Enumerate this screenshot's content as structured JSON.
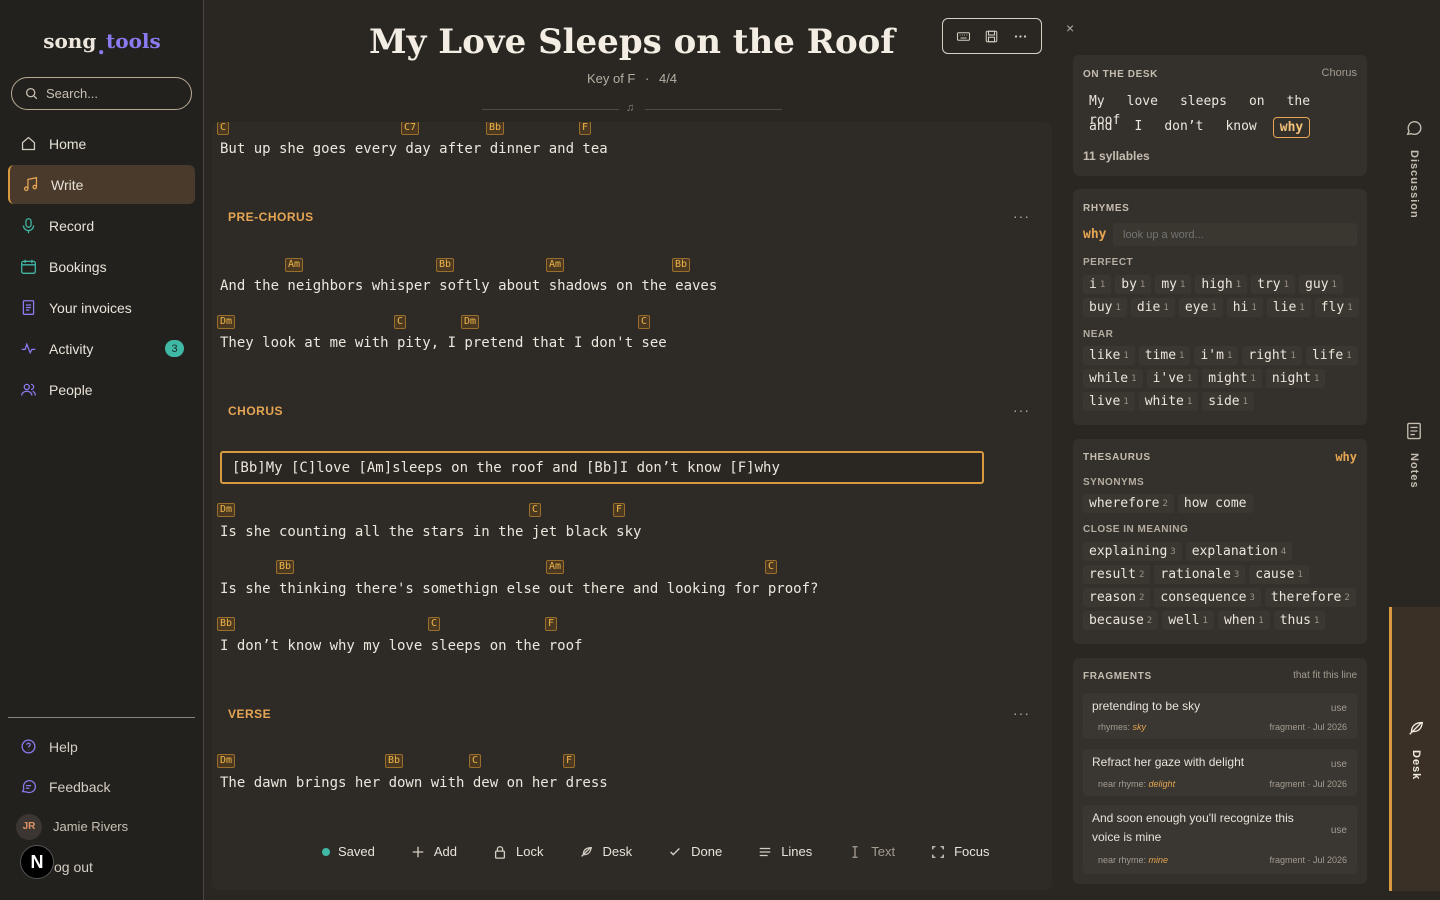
{
  "app": {
    "logo_a": "song",
    "logo_b": "tools"
  },
  "search": {
    "placeholder": "Search..."
  },
  "nav": {
    "home": "Home",
    "write": "Write",
    "record": "Record",
    "bookings": "Bookings",
    "invoices": "Your invoices",
    "activity": "Activity",
    "activity_badge": "3",
    "people": "People"
  },
  "bottom_nav": {
    "help": "Help",
    "feedback": "Feedback",
    "user_initials": "JR",
    "user_name": "Jamie Rivers",
    "logout": "og out",
    "n_logo": "N"
  },
  "song": {
    "title": "My Love Sleeps on the Roof",
    "key": "Key of F",
    "sep": "·",
    "time": "4/4"
  },
  "sections": {
    "pre_chorus": "PRE-CHORUS",
    "chorus": "CHORUS",
    "verse": "VERSE",
    "menu": "···"
  },
  "lines": {
    "l0": "But up she goes every day after dinner and tea",
    "l1": "And the neighbors whisper softly about shadows on the eaves",
    "l2": "They look at me with pity, I pretend that I don't see",
    "active": "[Bb]My [C]love [Am]sleeps on the roof and [Bb]I don’t know [F]why",
    "l3": "Is she counting all the stars in the jet black sky",
    "l4": "Is she thinking there's somethign else out there and looking for proof?",
    "l5": "I don’t know why my love sleeps on the roof",
    "l6": "The dawn brings her down with dew on her dress"
  },
  "chords": {
    "c0": [
      "C",
      "C7",
      "Bb",
      "F"
    ],
    "c1": [
      "Am",
      "Bb",
      "Am",
      "Bb"
    ],
    "c2": [
      "Dm",
      "C",
      "Dm",
      "C"
    ],
    "c3": [
      "Dm",
      "C",
      "F"
    ],
    "c4": [
      "Bb",
      "Am",
      "C"
    ],
    "c5": [
      "Bb",
      "C",
      "F"
    ],
    "c6": [
      "Dm",
      "Bb",
      "C",
      "F"
    ]
  },
  "bottom_tools": {
    "saved": "Saved",
    "add": "Add",
    "lock": "Lock",
    "desk": "Desk",
    "done": "Done",
    "lines": "Lines",
    "text": "Text",
    "focus": "Focus"
  },
  "desk": {
    "close": "×",
    "on_desk": {
      "label": "ON THE DESK",
      "section": "Chorus",
      "row1": [
        "My",
        "love",
        "sleeps",
        "on",
        "the",
        "roof"
      ],
      "row2": [
        "and",
        "I",
        "don’t",
        "know"
      ],
      "highlight": "why",
      "syllables": "11 syllables"
    },
    "rhymes": {
      "label": "RHYMES",
      "word": "why",
      "lookup_placeholder": "look up a word...",
      "perfect_label": "PERFECT",
      "perfect": [
        [
          "i",
          "1"
        ],
        [
          "by",
          "1"
        ],
        [
          "my",
          "1"
        ],
        [
          "high",
          "1"
        ],
        [
          "try",
          "1"
        ],
        [
          "guy",
          "1"
        ],
        [
          "buy",
          "1"
        ],
        [
          "die",
          "1"
        ],
        [
          "eye",
          "1"
        ],
        [
          "hi",
          "1"
        ],
        [
          "lie",
          "1"
        ],
        [
          "fly",
          "1"
        ]
      ],
      "near_label": "NEAR",
      "near": [
        [
          "like",
          "1"
        ],
        [
          "time",
          "1"
        ],
        [
          "i'm",
          "1"
        ],
        [
          "right",
          "1"
        ],
        [
          "life",
          "1"
        ],
        [
          "while",
          "1"
        ],
        [
          "i've",
          "1"
        ],
        [
          "might",
          "1"
        ],
        [
          "night",
          "1"
        ],
        [
          "live",
          "1"
        ],
        [
          "white",
          "1"
        ],
        [
          "side",
          "1"
        ]
      ]
    },
    "thesaurus": {
      "label": "THESAURUS",
      "word": "why",
      "syn_label": "SYNONYMS",
      "synonyms": [
        [
          "wherefore",
          "2"
        ],
        [
          "how come",
          ""
        ]
      ],
      "close_label": "CLOSE IN MEANING",
      "close": [
        [
          "explaining",
          "3"
        ],
        [
          "explanation",
          "4"
        ],
        [
          "result",
          "2"
        ],
        [
          "rationale",
          "3"
        ],
        [
          "cause",
          "1"
        ],
        [
          "reason",
          "2"
        ],
        [
          "consequence",
          "3"
        ],
        [
          "therefore",
          "2"
        ],
        [
          "because",
          "2"
        ],
        [
          "well",
          "1"
        ],
        [
          "when",
          "1"
        ],
        [
          "thus",
          "1"
        ]
      ]
    },
    "fragments": {
      "label": "FRAGMENTS",
      "hint": "that fit this line",
      "items": [
        {
          "text": "pretending to be sky",
          "use": "use",
          "rhyme_label": "rhymes:",
          "rhyme": "sky",
          "date": "fragment · Jul 2026"
        },
        {
          "text": "Refract her gaze with delight",
          "use": "use",
          "rhyme_label": "near rhyme:",
          "rhyme": "delight",
          "date": "fragment · Jul 2026"
        },
        {
          "text": "And soon enough you'll recognize this voice is mine",
          "use": "use",
          "rhyme_label": "near rhyme:",
          "rhyme": "mine",
          "date": "fragment · Jul 2026"
        }
      ]
    }
  },
  "rail": {
    "discussion": "Discussion",
    "notes": "Notes",
    "desk": "Desk"
  },
  "colors": {
    "accent": "#d99a3f",
    "chord": "#f0b64a",
    "teal": "#3fb9a6",
    "purple": "#8a7bf0"
  }
}
